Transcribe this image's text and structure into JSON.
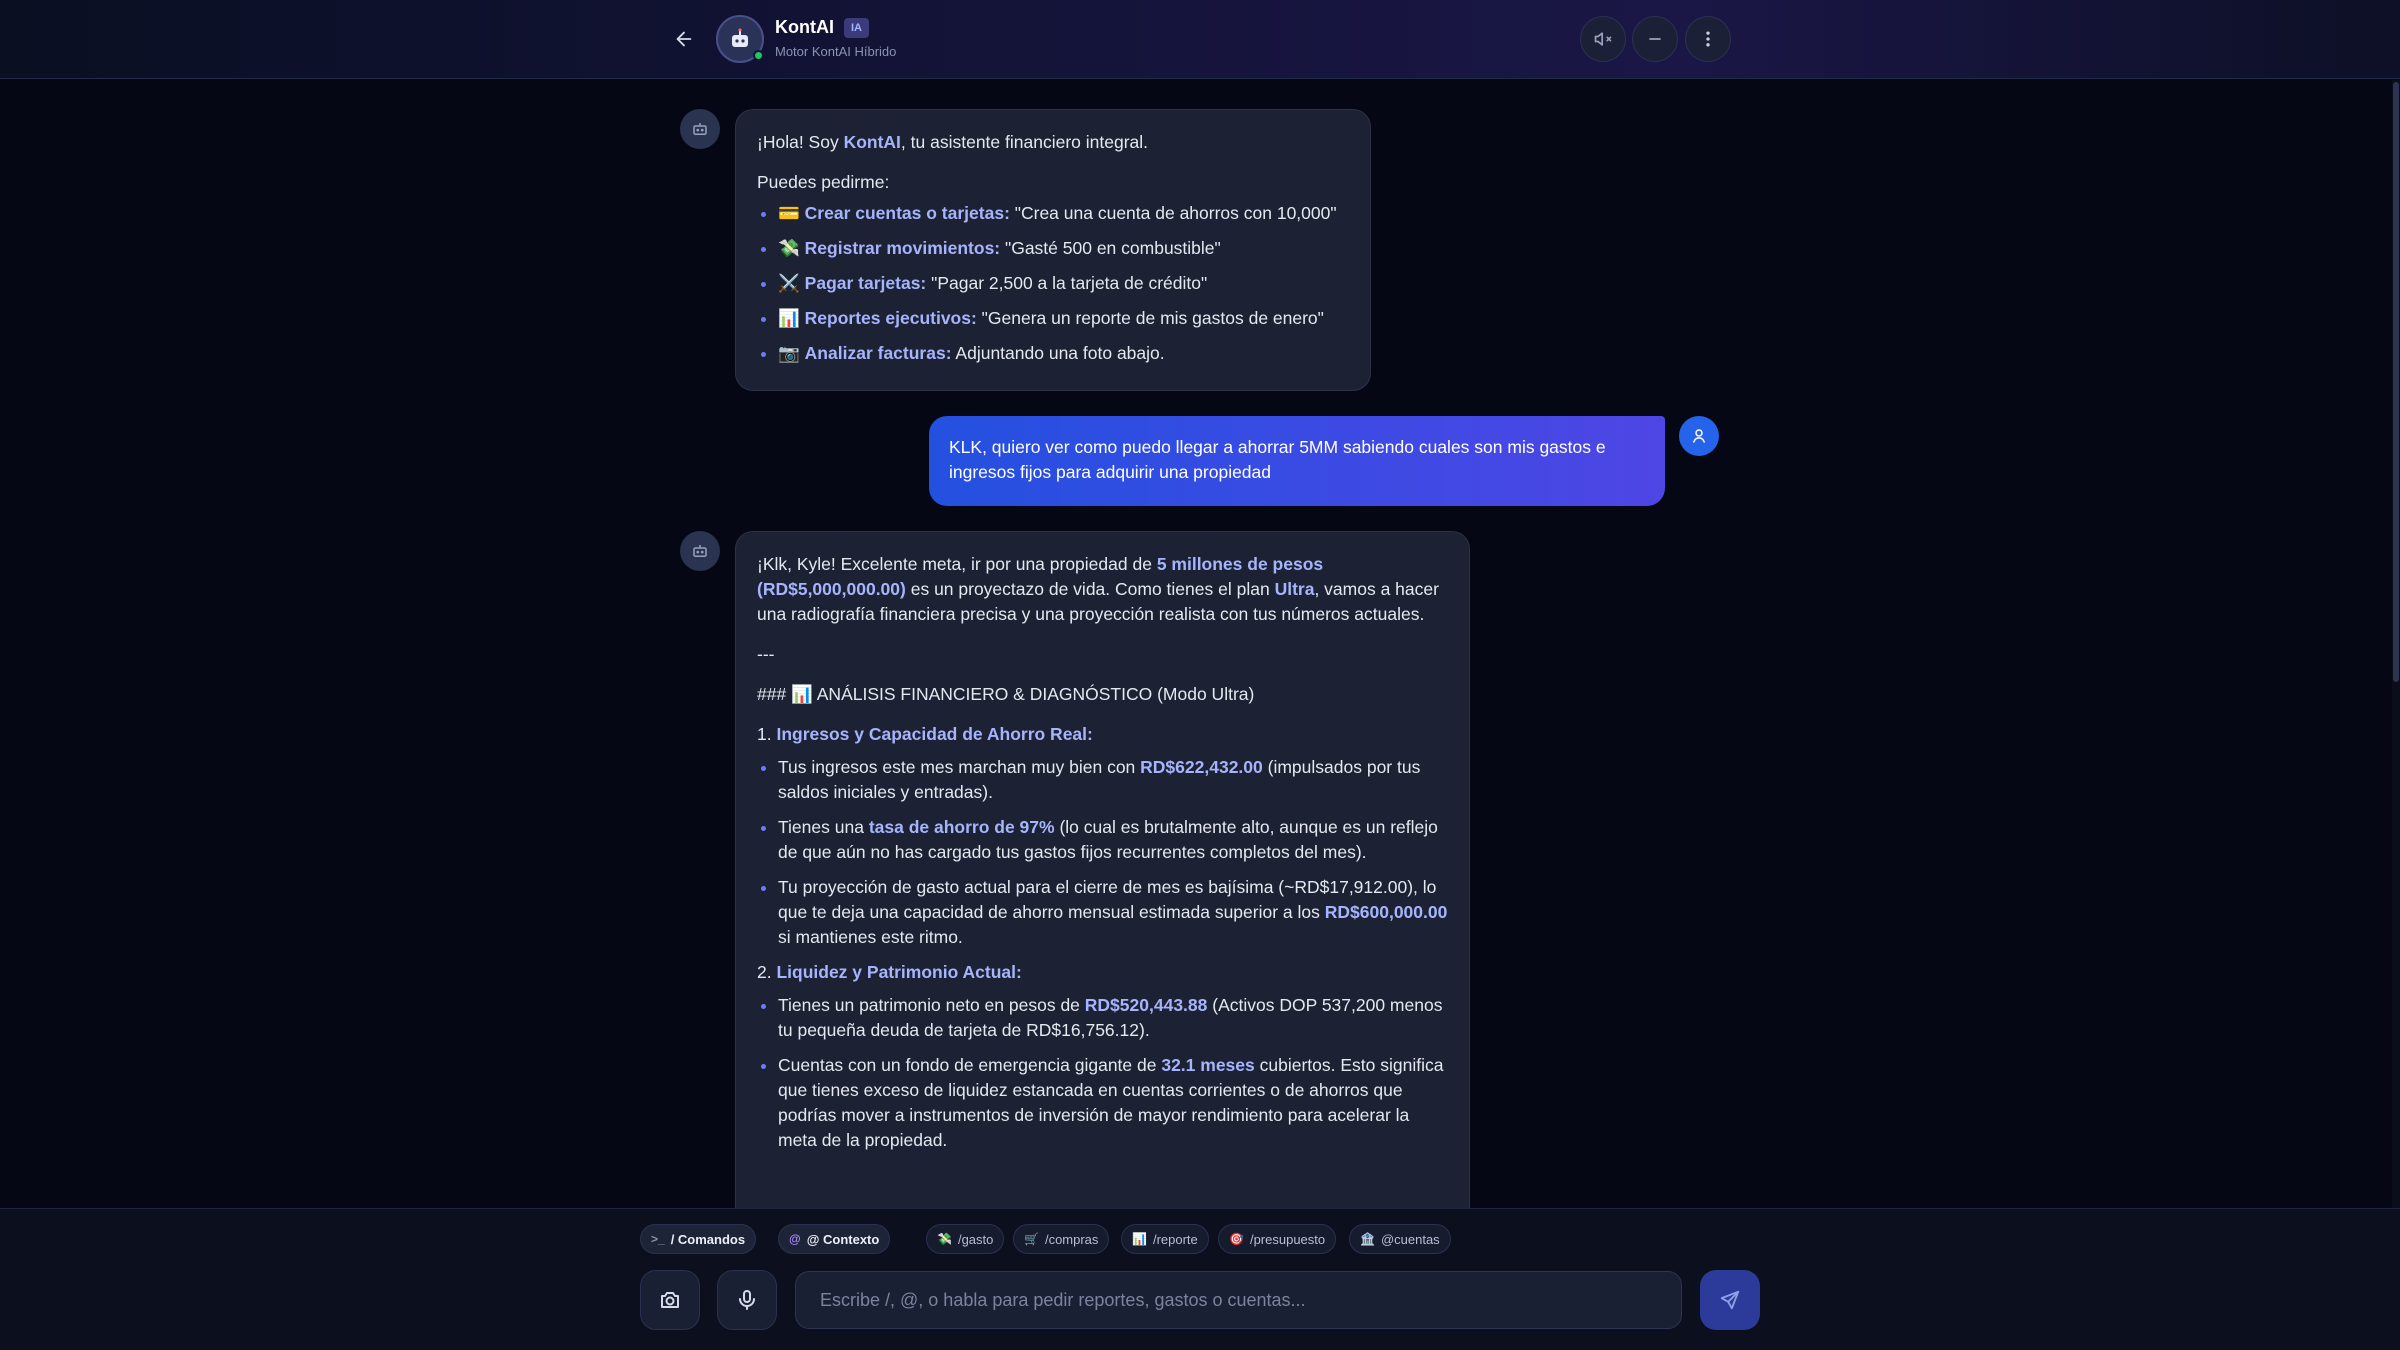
{
  "header": {
    "back_icon": "arrow-left-icon",
    "bot_icon": "robot-icon",
    "title": "KontAI",
    "badge": "IA",
    "subtitle": "Motor KontAI Híbrido",
    "mute_icon": "speaker-mute-icon",
    "minimize_icon": "minus-icon",
    "menu_icon": "more-vertical-icon",
    "status_color": "#22c55e"
  },
  "messages": {
    "greeting": {
      "hello_prefix": "¡Hola! Soy ",
      "hello_name": "KontAI",
      "hello_suffix": ", tu asistente financiero integral.",
      "intro": "Puedes pedirme:",
      "items": [
        {
          "emoji": "💳",
          "label": "Crear cuentas o tarjetas:",
          "text": " \"Crea una cuenta de ahorros con 10,000\""
        },
        {
          "emoji": "💸",
          "label": "Registrar movimientos:",
          "text": " \"Gasté 500 en combustible\""
        },
        {
          "emoji": "⚔️",
          "label": "Pagar tarjetas:",
          "text": " \"Pagar 2,500 a la tarjeta de crédito\""
        },
        {
          "emoji": "📊",
          "label": "Reportes ejecutivos:",
          "text": " \"Genera un reporte de mis gastos de enero\""
        },
        {
          "emoji": "📷",
          "label": "Analizar facturas:",
          "text": " Adjuntando una foto abajo."
        }
      ]
    },
    "user": {
      "text": "KLK, quiero ver como puedo llegar a ahorrar 5MM sabiendo cuales son mis gastos e ingresos fijos para adquirir una propiedad"
    },
    "analysis": {
      "p1_a": "¡Klk, Kyle! Excelente meta, ir por una propiedad de ",
      "p1_hl1": "5 millones de pesos (RD$5,000,000.00)",
      "p1_b": " es un proyectazo de vida. Como tienes el plan ",
      "p1_hl2": "Ultra",
      "p1_c": ", vamos a hacer una radiografía financiera precisa y una proyección realista con tus números actuales.",
      "divider": "---",
      "heading_prefix": "### ",
      "heading_emoji": "📊",
      "heading_text": " ANÁLISIS FINANCIERO & DIAGNÓSTICO (Modo Ultra)",
      "s1_num": "1. ",
      "s1_title": "Ingresos y Capacidad de Ahorro Real:",
      "s1_i1_a": "Tus ingresos este mes marchan muy bien con ",
      "s1_i1_hl": "RD$622,432.00",
      "s1_i1_b": " (impulsados por tus saldos iniciales y entradas).",
      "s1_i2_a": "Tienes una ",
      "s1_i2_hl": "tasa de ahorro de 97%",
      "s1_i2_b": " (lo cual es brutalmente alto, aunque es un reflejo de que aún no has cargado tus gastos fijos recurrentes completos del mes).",
      "s1_i3_a": "Tu proyección de gasto actual para el cierre de mes es bajísima (~RD$17,912.00), lo que te deja una capacidad de ahorro mensual estimada superior a los ",
      "s1_i3_hl": "RD$600,000.00",
      "s1_i3_b": " si mantienes este ritmo.",
      "s2_num": "2. ",
      "s2_title": "Liquidez y Patrimonio Actual:",
      "s2_i1_a": "Tienes un patrimonio neto en pesos de ",
      "s2_i1_hl": "RD$520,443.88",
      "s2_i1_b": " (Activos DOP 537,200 menos tu pequeña deuda de tarjeta de RD$16,756.12).",
      "s2_i2_a": "Cuentas con un fondo de emergencia gigante de ",
      "s2_i2_hl": "32.1 meses",
      "s2_i2_b": " cubiertos. Esto significa que tienes exceso de liquidez estancada en cuentas corrientes o de ahorros que podrías mover a instrumentos de inversión de mayor rendimiento para acelerar la meta de la propiedad."
    }
  },
  "composer": {
    "chips": [
      {
        "icon": ">_",
        "label": "/ Comandos"
      },
      {
        "icon": "@",
        "label": "@ Contexto"
      },
      {
        "icon": "💸",
        "label": "/gasto"
      },
      {
        "icon": "🛒",
        "label": "/compras"
      },
      {
        "icon": "📊",
        "label": "/reporte"
      },
      {
        "icon": "🎯",
        "label": "/presupuesto"
      },
      {
        "icon": "🏦",
        "label": "@cuentas"
      }
    ],
    "camera_icon": "camera-icon",
    "mic_icon": "microphone-icon",
    "placeholder": "Escribe /, @, o habla para pedir reportes, gastos o cuentas...",
    "send_icon": "send-icon"
  }
}
